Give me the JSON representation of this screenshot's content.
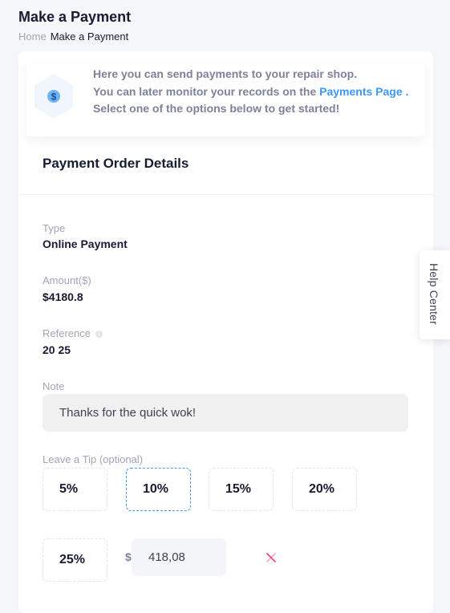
{
  "header": {
    "title": "Make a Payment",
    "breadcrumb": [
      "Home",
      "Make a Payment"
    ]
  },
  "notice": {
    "icon": "dollar-icon",
    "line1": "Here you can send payments to your repair shop.",
    "line2_prefix": "You can later monitor your records on the ",
    "line2_link": "Payments Page",
    "line2_suffix": " .",
    "line3": "Select one of the options below to get started!"
  },
  "details": {
    "section_title": "Payment Order Details",
    "type_label": "Type",
    "type_value": "Online Payment",
    "amount_label": "Amount($)",
    "amount_value": "$4180.8",
    "reference_label": "Reference",
    "reference_value": "20 25",
    "note_label": "Note",
    "note_value": "Thanks for the quick wok!"
  },
  "tip": {
    "label": "Leave a Tip (optional)",
    "options": [
      "5%",
      "10%",
      "15%",
      "20%",
      "25%"
    ],
    "selected_index": 1,
    "currency_symbol": "$",
    "custom_value": "418,08"
  },
  "help_center": {
    "label": "Help Center"
  },
  "colors": {
    "accent": "#3e97ff",
    "clear_icon": "#f1416c"
  }
}
